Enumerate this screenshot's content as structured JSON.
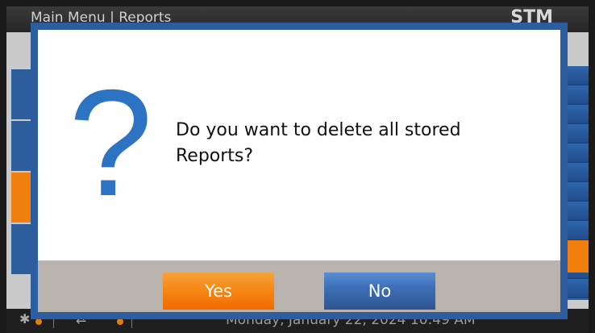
{
  "header": {
    "breadcrumb": "Main Menu | Reports",
    "brand": "STM"
  },
  "statusbar": {
    "datetime": "Monday, January 22, 2024 10:49 AM"
  },
  "dialog": {
    "message": "Do you want to delete all stored Reports?",
    "yes_label": "Yes",
    "no_label": "No"
  },
  "colors": {
    "dialog_border": "#2d5d9f",
    "question_icon": "#2c73c4",
    "yes_button": "#f58a16",
    "no_button": "#3d6fb8",
    "button_bar": "#b8b3ad"
  }
}
